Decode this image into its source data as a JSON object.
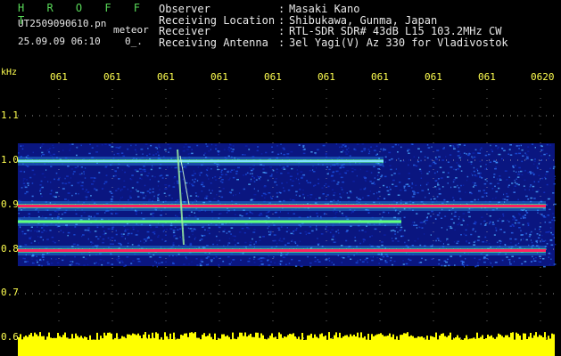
{
  "header": {
    "brand": "H R O F F T",
    "filename": "UT2509090610.pn",
    "tag": "meteor",
    "datetime": "25.09.09 06:10",
    "code": "0_."
  },
  "meta": [
    {
      "label": "Observer",
      "sep": ":",
      "value": "Masaki Kano"
    },
    {
      "label": "Receiving Location",
      "sep": ":",
      "value": "Shibukawa, Gunma, Japan"
    },
    {
      "label": "Receiver",
      "sep": ":",
      "value": "RTL-SDR SDR# 43dB L15 103.2MHz CW"
    },
    {
      "label": "Receiving Antenna",
      "sep": ":",
      "value": "3el Yagi(V) Az 330 for Vladivostok"
    }
  ],
  "axis": {
    "unit": "kHz",
    "time_ticks": [
      "061",
      "061",
      "061",
      "061",
      "061",
      "061",
      "061",
      "061",
      "061",
      "0620"
    ],
    "freq_ticks": [
      "1.1",
      "1.0",
      "0.9",
      "0.8",
      "0.7",
      "0.6"
    ]
  },
  "colors": {
    "text": "#e8e8e8",
    "brand": "#58d858",
    "axis": "#ffff50",
    "bar": "#ffff00",
    "band_hot": "#ff2060",
    "band_warm": "#60ff80",
    "noise": "#1428b4"
  }
}
